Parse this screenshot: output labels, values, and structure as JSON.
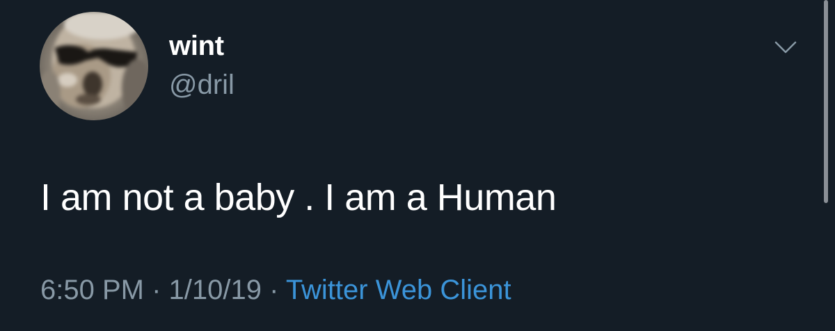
{
  "tweet": {
    "author": {
      "display_name": "wint",
      "handle": "@dril"
    },
    "text": "I am not a baby . I am a Human",
    "time": "6:50 PM",
    "date": "1/10/19",
    "source": "Twitter Web Client",
    "separator": " · "
  },
  "icons": {
    "more": "chevron-down-icon",
    "avatar": "avatar"
  },
  "colors": {
    "background": "#141d26",
    "text": "#ffffff",
    "muted": "#8899a6",
    "link": "#3b94d9"
  }
}
